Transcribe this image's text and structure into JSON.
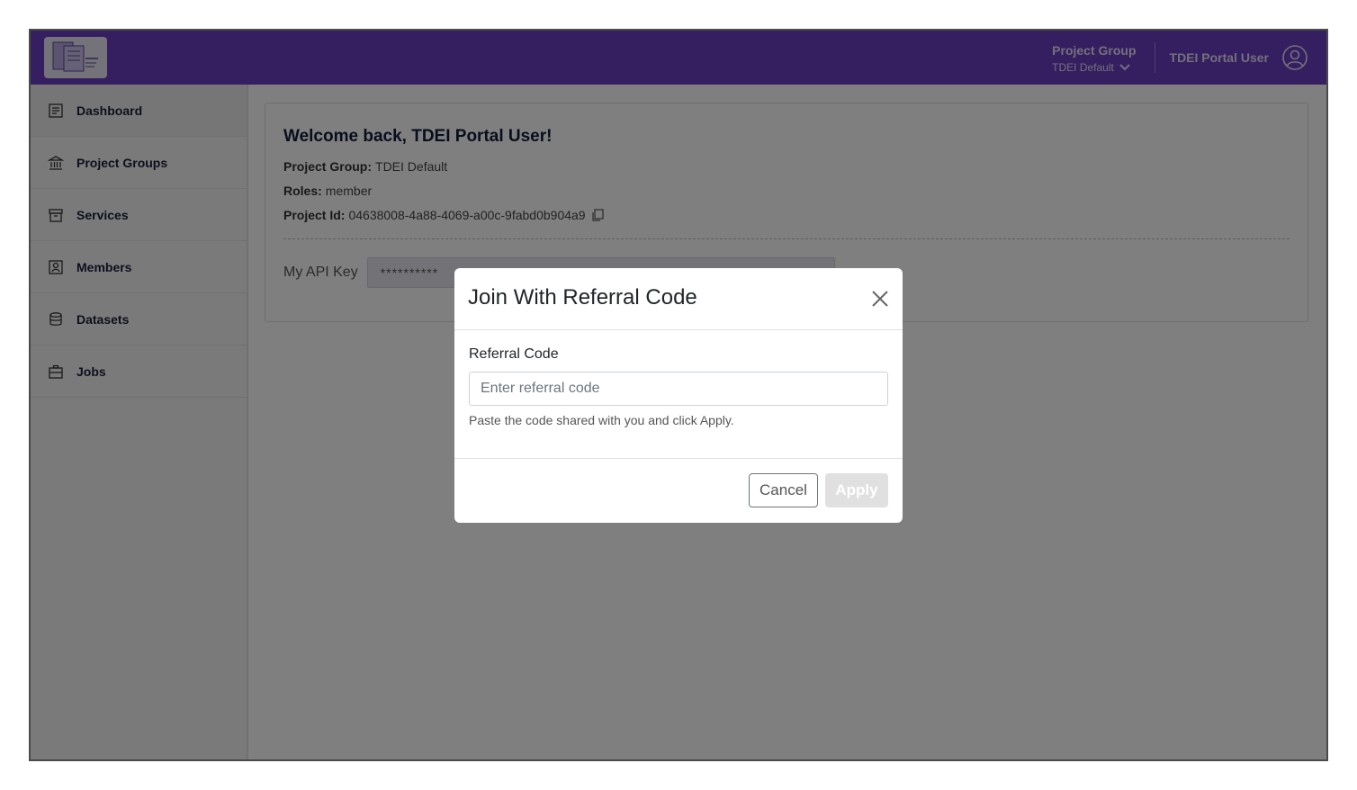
{
  "header": {
    "project_group_label": "Project Group",
    "project_group_value": "TDEI Default",
    "user_name": "TDEI Portal User"
  },
  "sidebar": {
    "items": [
      {
        "label": "Dashboard",
        "icon": "dashboard-icon"
      },
      {
        "label": "Project Groups",
        "icon": "bank-icon"
      },
      {
        "label": "Services",
        "icon": "archive-icon"
      },
      {
        "label": "Members",
        "icon": "member-badge-icon"
      },
      {
        "label": "Datasets",
        "icon": "database-icon"
      },
      {
        "label": "Jobs",
        "icon": "briefcase-icon"
      }
    ]
  },
  "main": {
    "welcome": "Welcome back, TDEI Portal User!",
    "project_group_key": "Project Group:",
    "project_group_value": "TDEI Default",
    "roles_key": "Roles:",
    "roles_value": "member",
    "project_id_key": "Project Id:",
    "project_id_value": "04638008-4a88-4069-a00c-9fabd0b904a9",
    "api_key_label": "My API Key",
    "api_key_value": "**********"
  },
  "modal": {
    "title": "Join With Referral Code",
    "field_label": "Referral Code",
    "input_value": "",
    "input_placeholder": "Enter referral code",
    "hint": "Paste the code shared with you and click Apply.",
    "cancel_label": "Cancel",
    "apply_label": "Apply"
  },
  "colors": {
    "header_bg": "#6a3fc3",
    "overlay": "rgba(0,0,0,0.5)",
    "apply_disabled": "#e0e0e0"
  }
}
